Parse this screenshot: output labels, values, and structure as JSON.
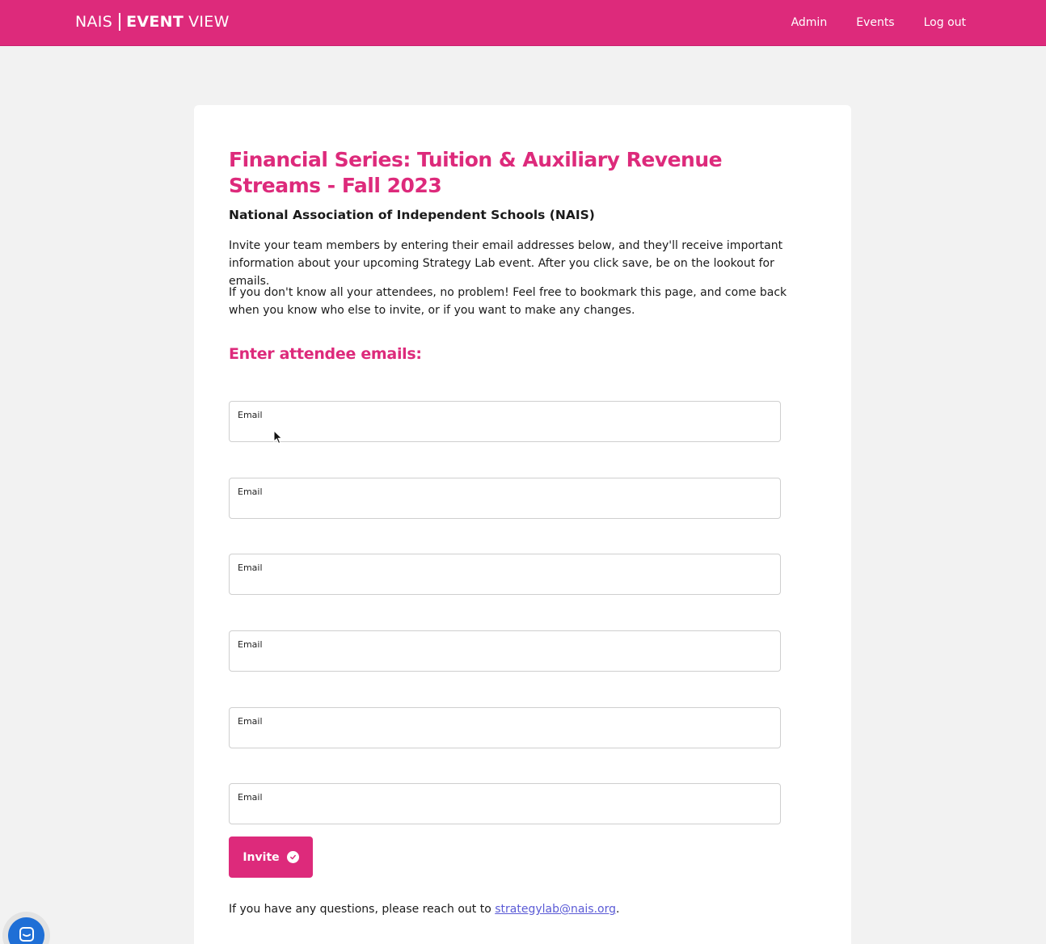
{
  "header": {
    "logo_left": "NAIS",
    "logo_bold": "EVENT",
    "logo_right": "VIEW",
    "nav": [
      "Admin",
      "Events",
      "Log out"
    ],
    "brand_color": "#dd2a7b"
  },
  "main": {
    "title": "Financial Series: Tuition & Auxiliary Revenue Streams - Fall 2023",
    "organization": "National Association of Independent Schools (NAIS)",
    "intro_1": "Invite your team members by entering their email addresses below, and they'll receive important information about your upcoming Strategy Lab event. After you click save, be on the lookout for emails.",
    "intro_2": "If you don't know all your attendees, no problem! Feel free to bookmark this page, and come back when you know who else to invite, or if you want to make any changes.",
    "section_title": "Enter attendee emails:",
    "fields": [
      {
        "label": "Email",
        "value": ""
      },
      {
        "label": "Email",
        "value": ""
      },
      {
        "label": "Email",
        "value": ""
      },
      {
        "label": "Email",
        "value": ""
      },
      {
        "label": "Email",
        "value": ""
      },
      {
        "label": "Email",
        "value": ""
      }
    ],
    "invite_label": "Invite",
    "footer_prefix": "If you have any questions, please reach out to ",
    "footer_email": "strategylab@nais.org",
    "footer_suffix": "."
  },
  "widgets": {
    "chat_icon": "chat-bubble-icon",
    "chat_color": "#1f6fd6"
  }
}
